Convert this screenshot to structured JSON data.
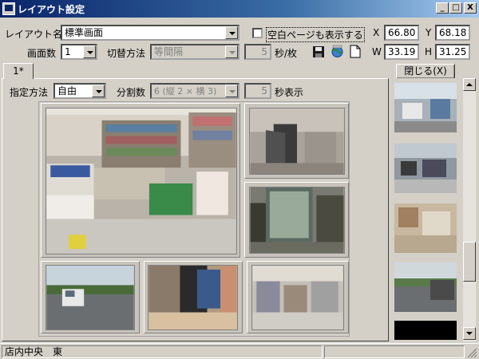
{
  "window": {
    "title": "レイアウト設定",
    "minimize_glyph": "_",
    "maximize_glyph": "□",
    "close_glyph": "X"
  },
  "toolbar": {
    "layout_name_label": "レイアウト名",
    "layout_name_value": "標準画面",
    "blank_page_label": "空白ページも表示する",
    "screen_count_label": "画面数",
    "screen_count_value": "1",
    "switch_method_label": "切替方法",
    "switch_method_value": "等間隔",
    "seconds_value": "5",
    "seconds_unit": "秒/枚",
    "icons": [
      "save-icon",
      "globe-icon",
      "new-page-icon"
    ]
  },
  "coords": {
    "x_label": "X",
    "x_value": "66.80",
    "y_label": "Y",
    "y_value": "68.18",
    "w_label": "W",
    "w_value": "33.19",
    "h_label": "H",
    "h_value": "31.25"
  },
  "tabs": [
    {
      "label": "1*"
    }
  ],
  "close_button": "閉じる(X)",
  "panel": {
    "method_label": "指定方法",
    "method_value": "自由",
    "split_label": "分割数",
    "split_value": "6 (縦 2 × 横 3)",
    "display_seconds_value": "5",
    "display_seconds_label": "秒表示"
  },
  "cameras": [
    {
      "scene": "store-interior-wide"
    },
    {
      "scene": "office-doorway"
    },
    {
      "scene": "glass-entrance"
    },
    {
      "scene": "parking-lot-truck"
    },
    {
      "scene": "store-exterior-storefront"
    },
    {
      "scene": "store-aisle-shelves"
    }
  ],
  "thumbnails": [
    {
      "scene": "office-desks"
    },
    {
      "scene": "office-workers"
    },
    {
      "scene": "stockroom-boxes"
    },
    {
      "scene": "parking-lot-car"
    },
    {
      "scene": "no-signal-black"
    }
  ],
  "status": {
    "camera_name": "店内中央　東"
  }
}
